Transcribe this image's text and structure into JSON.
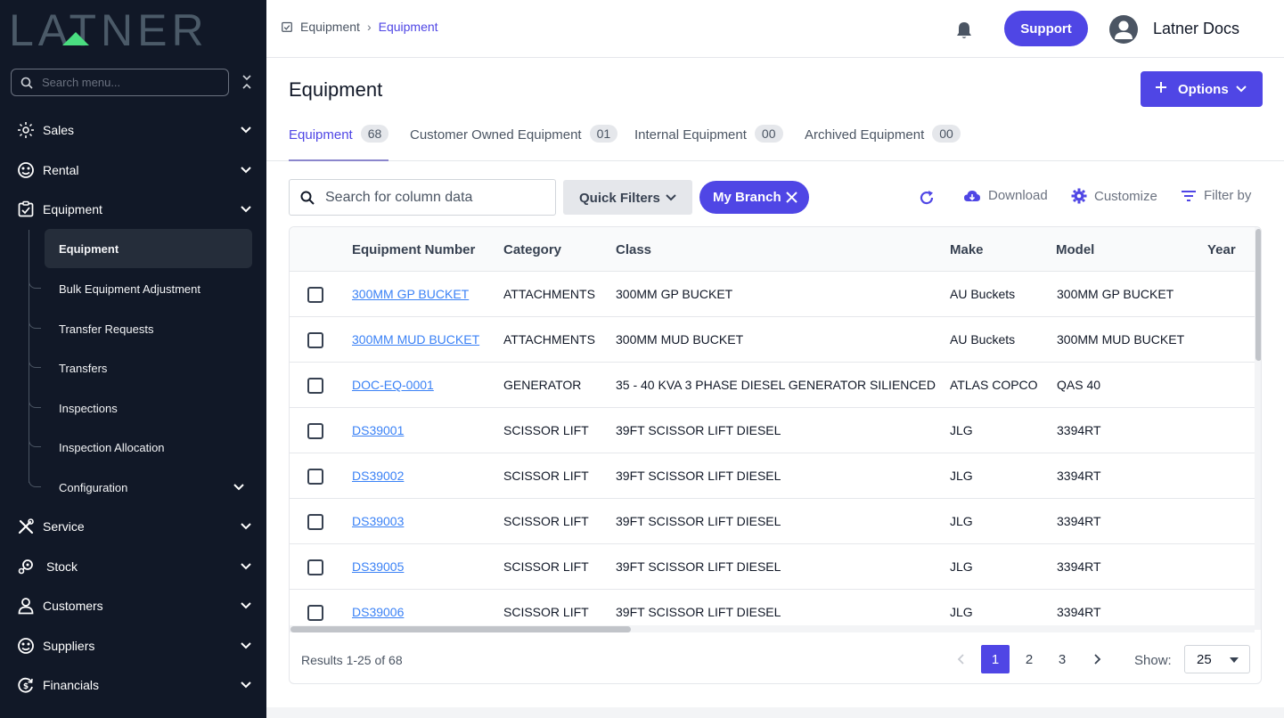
{
  "sidebar": {
    "logo_text": "LATNER",
    "search_placeholder": "Search menu...",
    "items": [
      {
        "label": "Sales",
        "icon": "sales-icon"
      },
      {
        "label": "Rental",
        "icon": "rental-icon"
      },
      {
        "label": "Equipment",
        "icon": "equipment-icon"
      },
      {
        "label": "Service",
        "icon": "service-icon"
      },
      {
        "label": "Stock",
        "icon": "stock-icon"
      },
      {
        "label": "Customers",
        "icon": "customers-icon"
      },
      {
        "label": "Suppliers",
        "icon": "suppliers-icon"
      },
      {
        "label": "Financials",
        "icon": "financials-icon"
      }
    ],
    "sub_items": [
      {
        "label": "Equipment"
      },
      {
        "label": "Bulk Equipment Adjustment"
      },
      {
        "label": "Transfer Requests"
      },
      {
        "label": "Transfers"
      },
      {
        "label": "Inspections"
      },
      {
        "label": "Inspection Allocation"
      },
      {
        "label": "Configuration"
      }
    ]
  },
  "topbar": {
    "breadcrumb": [
      "Equipment",
      "Equipment"
    ],
    "support_label": "Support",
    "user_name": "Latner Docs"
  },
  "page": {
    "title": "Equipment",
    "options_label": "Options"
  },
  "tabs": [
    {
      "label": "Equipment",
      "count": "68"
    },
    {
      "label": "Customer Owned Equipment",
      "count": "01"
    },
    {
      "label": "Internal Equipment",
      "count": "00"
    },
    {
      "label": "Archived Equipment",
      "count": "00"
    }
  ],
  "toolbar": {
    "search_placeholder": "Search for column data",
    "quick_filters_label": "Quick Filters",
    "chip_label": "My Branch",
    "download_label": "Download",
    "customize_label": "Customize",
    "filter_label": "Filter by"
  },
  "table": {
    "columns": [
      "Equipment Number",
      "Category",
      "Class",
      "Make",
      "Model",
      "Year"
    ],
    "rows": [
      [
        "300MM GP BUCKET",
        "ATTACHMENTS",
        "300MM GP BUCKET",
        "AU Buckets",
        "300MM GP BUCKET",
        ""
      ],
      [
        "300MM MUD BUCKET",
        "ATTACHMENTS",
        "300MM MUD BUCKET",
        "AU Buckets",
        "300MM MUD BUCKET",
        ""
      ],
      [
        "DOC-EQ-0001",
        "GENERATOR",
        "35 - 40 KVA 3 PHASE DIESEL GENERATOR SILIENCED",
        "ATLAS COPCO",
        "QAS 40",
        ""
      ],
      [
        "DS39001",
        "SCISSOR LIFT",
        "39FT SCISSOR LIFT DIESEL",
        "JLG",
        "3394RT",
        ""
      ],
      [
        "DS39002",
        "SCISSOR LIFT",
        "39FT SCISSOR LIFT DIESEL",
        "JLG",
        "3394RT",
        ""
      ],
      [
        "DS39003",
        "SCISSOR LIFT",
        "39FT SCISSOR LIFT DIESEL",
        "JLG",
        "3394RT",
        ""
      ],
      [
        "DS39005",
        "SCISSOR LIFT",
        "39FT SCISSOR LIFT DIESEL",
        "JLG",
        "3394RT",
        ""
      ],
      [
        "DS39006",
        "SCISSOR LIFT",
        "39FT SCISSOR LIFT DIESEL",
        "JLG",
        "3394RT",
        ""
      ]
    ]
  },
  "pagination": {
    "results_text": "Results 1-25 of 68",
    "pages": [
      "1",
      "2",
      "3"
    ],
    "current_page": "1",
    "show_label": "Show:",
    "page_size": "25"
  },
  "colors": {
    "sidebar_bg": "#111827",
    "accent": "#4f46e5",
    "link": "#3b82f6",
    "logo_green": "#4ade80",
    "logo_gray": "#4b5a68"
  }
}
